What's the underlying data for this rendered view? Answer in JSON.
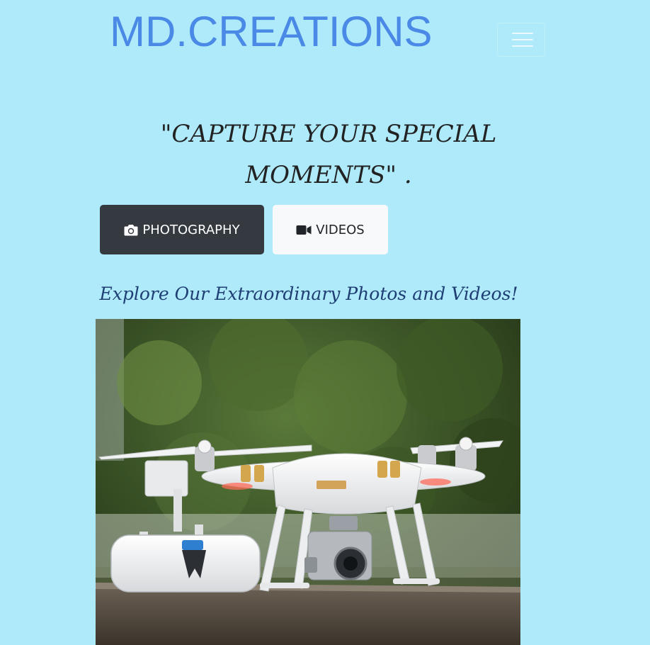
{
  "navbar": {
    "brand": "MD.CREATIONS",
    "toggler_icon": "hamburger-icon"
  },
  "hero": {
    "tagline": "\"CAPTURE YOUR SPECIAL MOMENTS\" .",
    "buttons": [
      {
        "label": "PHOTOGRAPHY",
        "icon": "camera-icon"
      },
      {
        "label": "VIDEOS",
        "icon": "video-camera-icon"
      }
    ],
    "explore_text": "Explore Our Extraordinary Photos and Videos!"
  },
  "image": {
    "subject": "drone-with-remote-controller"
  },
  "colors": {
    "background": "#aeeafa",
    "brand": "#4a8ae6",
    "dark_button": "#343a40",
    "light_button": "#f8f9fa",
    "explore_text": "#1f3f74"
  }
}
